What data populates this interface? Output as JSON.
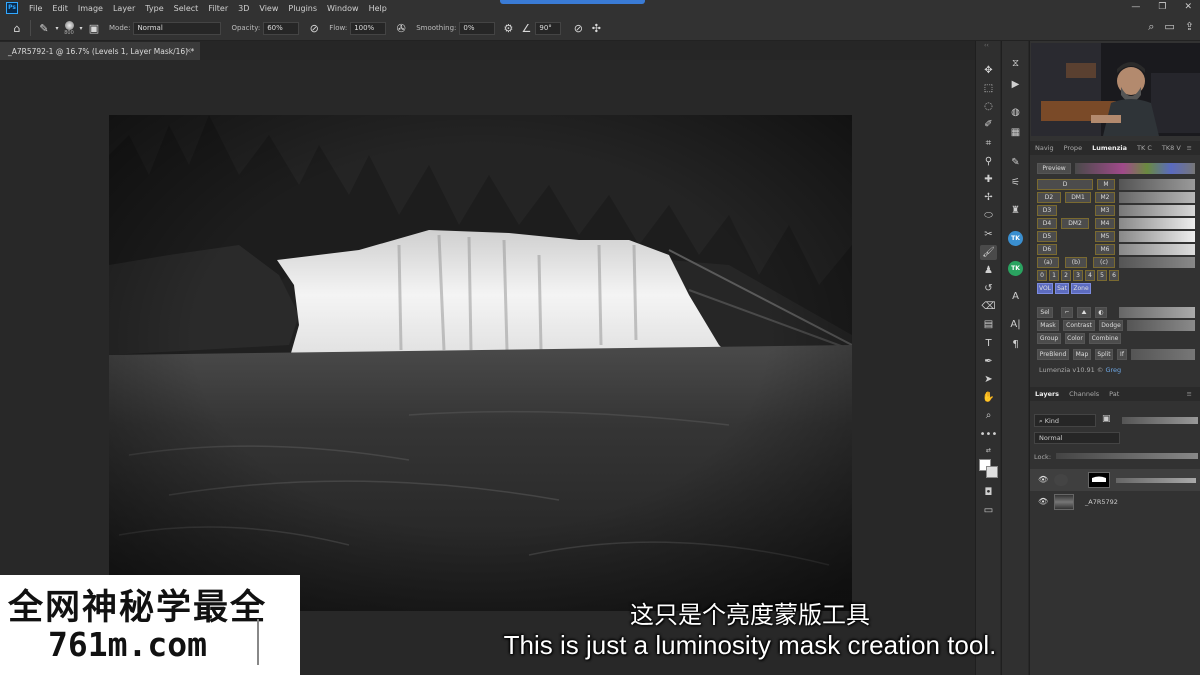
{
  "app": {
    "logo_text": "Ps",
    "menu": [
      "File",
      "Edit",
      "Image",
      "Layer",
      "Type",
      "Select",
      "Filter",
      "3D",
      "View",
      "Plugins",
      "Window",
      "Help"
    ],
    "window_controls": [
      "—",
      "❐",
      "✕"
    ]
  },
  "options_bar": {
    "brush_size": "800",
    "mode_label": "Mode:",
    "mode_value": "Normal",
    "opacity_label": "Opacity:",
    "opacity_value": "60%",
    "flow_label": "Flow:",
    "flow_value": "100%",
    "smoothing_label": "Smoothing:",
    "smoothing_value": "0%",
    "angle_value": "90°"
  },
  "document": {
    "tab_title": "_A7R5792-1 @ 16.7% (Levels 1, Layer Mask/16) *",
    "tab_close": "×"
  },
  "panels": {
    "top_tabs": [
      "Navig",
      "Prope",
      "Lumenzia",
      "TK C",
      "TK8 V"
    ],
    "active_top_tab": "Lumenzia",
    "panel_menu": "≡"
  },
  "lumenzia": {
    "preview_label": "Preview",
    "row_d": {
      "d": "D",
      "m": "M"
    },
    "row_d2": {
      "d2": "D2",
      "dm1": "DM1",
      "m2": "M2"
    },
    "row_d3": {
      "d3": "D3",
      "m3": "M3"
    },
    "row_d4": {
      "d4": "D4",
      "dm2": "DM2",
      "m4": "M4"
    },
    "row_d5": {
      "d5": "D5",
      "m5": "M5"
    },
    "row_d6": {
      "d6": "D6",
      "m6": "M6"
    },
    "row_zone": {
      "a": "(a)",
      "b": "(b)",
      "c": "(c)"
    },
    "numbers": [
      "0",
      "1",
      "2",
      "3",
      "4",
      "5",
      "6"
    ],
    "blue_buttons": [
      "VOL",
      "Sat",
      "Zone"
    ],
    "sel_label": "Sel",
    "mask_row": [
      "Mask",
      "Contrast",
      "Dodge"
    ],
    "group_row": [
      "Group",
      "Color",
      "Combine"
    ],
    "preblend_row": [
      "PreBlend",
      "Map",
      "Split",
      "If"
    ],
    "version": "Lumenzia v10.91 ©",
    "author": "Greg"
  },
  "layers_panel": {
    "tabs": [
      "Layers",
      "Channels",
      "Pat"
    ],
    "active_tab": "Layers",
    "kind_label": "Kind",
    "blend_mode": "Normal",
    "lock_label": "Lock:",
    "layers": [
      {
        "name": "",
        "type": "adjustment-with-mask",
        "visible": true,
        "selected": true
      },
      {
        "name": "_A7R5792",
        "type": "image",
        "visible": true,
        "selected": false
      }
    ]
  },
  "watermark": {
    "title": "全网神秘学最全",
    "url": "761m.com"
  },
  "subtitles": {
    "chinese": "这只是个亮度蒙版工具",
    "english": "This is just a luminosity mask creation tool."
  }
}
